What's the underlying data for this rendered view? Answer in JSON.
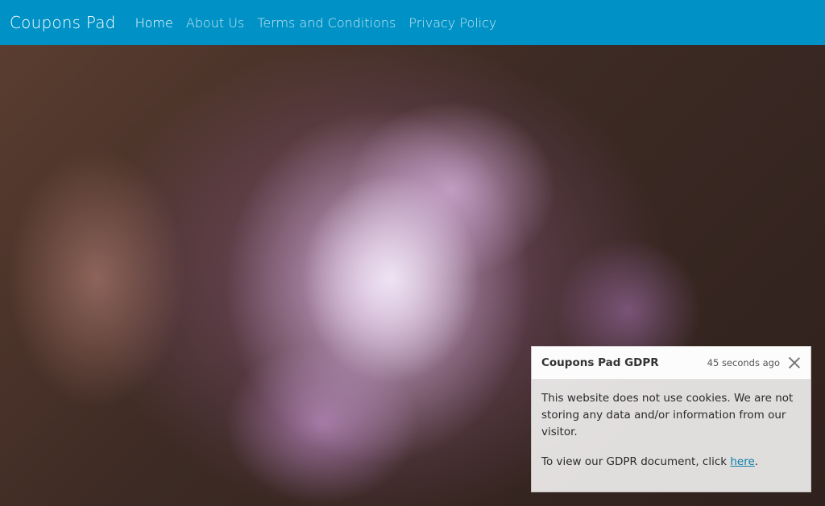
{
  "navbar": {
    "brand": "Coupons Pad",
    "links": [
      {
        "label": "Home",
        "active": true
      },
      {
        "label": "About Us"
      },
      {
        "label": "Terms and Conditions"
      },
      {
        "label": "Privacy Policy"
      }
    ],
    "color": "#0092c6"
  },
  "toast": {
    "title": "Coupons Pad GDPR",
    "time": "45 seconds ago",
    "close_icon": "close-icon",
    "message": "This website does not use cookies. We are not storing any data and/or information from our visitor.",
    "gdpr_prefix": "To view our GDPR document, click ",
    "gdpr_link": "here",
    "gdpr_suffix": "."
  }
}
